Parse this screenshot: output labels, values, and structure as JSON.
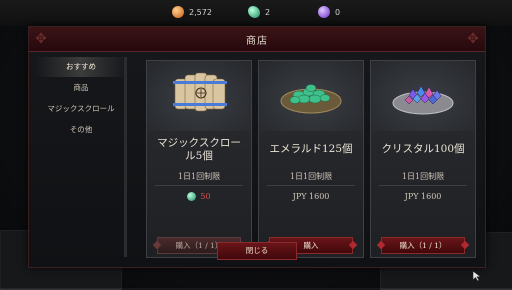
{
  "currency": {
    "gold": "2,572",
    "emerald": "2",
    "crystal": "0"
  },
  "shop": {
    "title": "商店",
    "close_label": "閉じる",
    "tabs": [
      {
        "label": "おすすめ",
        "active": true
      },
      {
        "label": "商品",
        "active": false
      },
      {
        "label": "マジックスクロール",
        "active": false
      },
      {
        "label": "その他",
        "active": false
      }
    ],
    "items": [
      {
        "name_line1": "マジックスクロー",
        "name_line2": "ル5個",
        "limit": "1日1回制限",
        "price": "50",
        "buy_label": "購入（1 / 1）",
        "icon": "scroll-bundle-icon",
        "price_icon": "emerald-icon",
        "disabled": true
      },
      {
        "name_line1": "エメラルド125個",
        "name_line2": "",
        "limit": "1日1回制限",
        "price": "JPY 1600",
        "buy_label": "購入",
        "icon": "emerald-pile-icon",
        "disabled": false
      },
      {
        "name_line1": "クリスタル100個",
        "name_line2": "",
        "limit": "1日1回制限",
        "price": "JPY 1600",
        "buy_label": "購入（1 / 1）",
        "icon": "crystal-pile-icon",
        "disabled": false
      }
    ]
  },
  "colors": {
    "accent_red": "#6a1519",
    "price_red": "#e05050",
    "emerald": "#3fbf8a",
    "crystal": "#8b5cf6",
    "gold": "#e8883a"
  }
}
